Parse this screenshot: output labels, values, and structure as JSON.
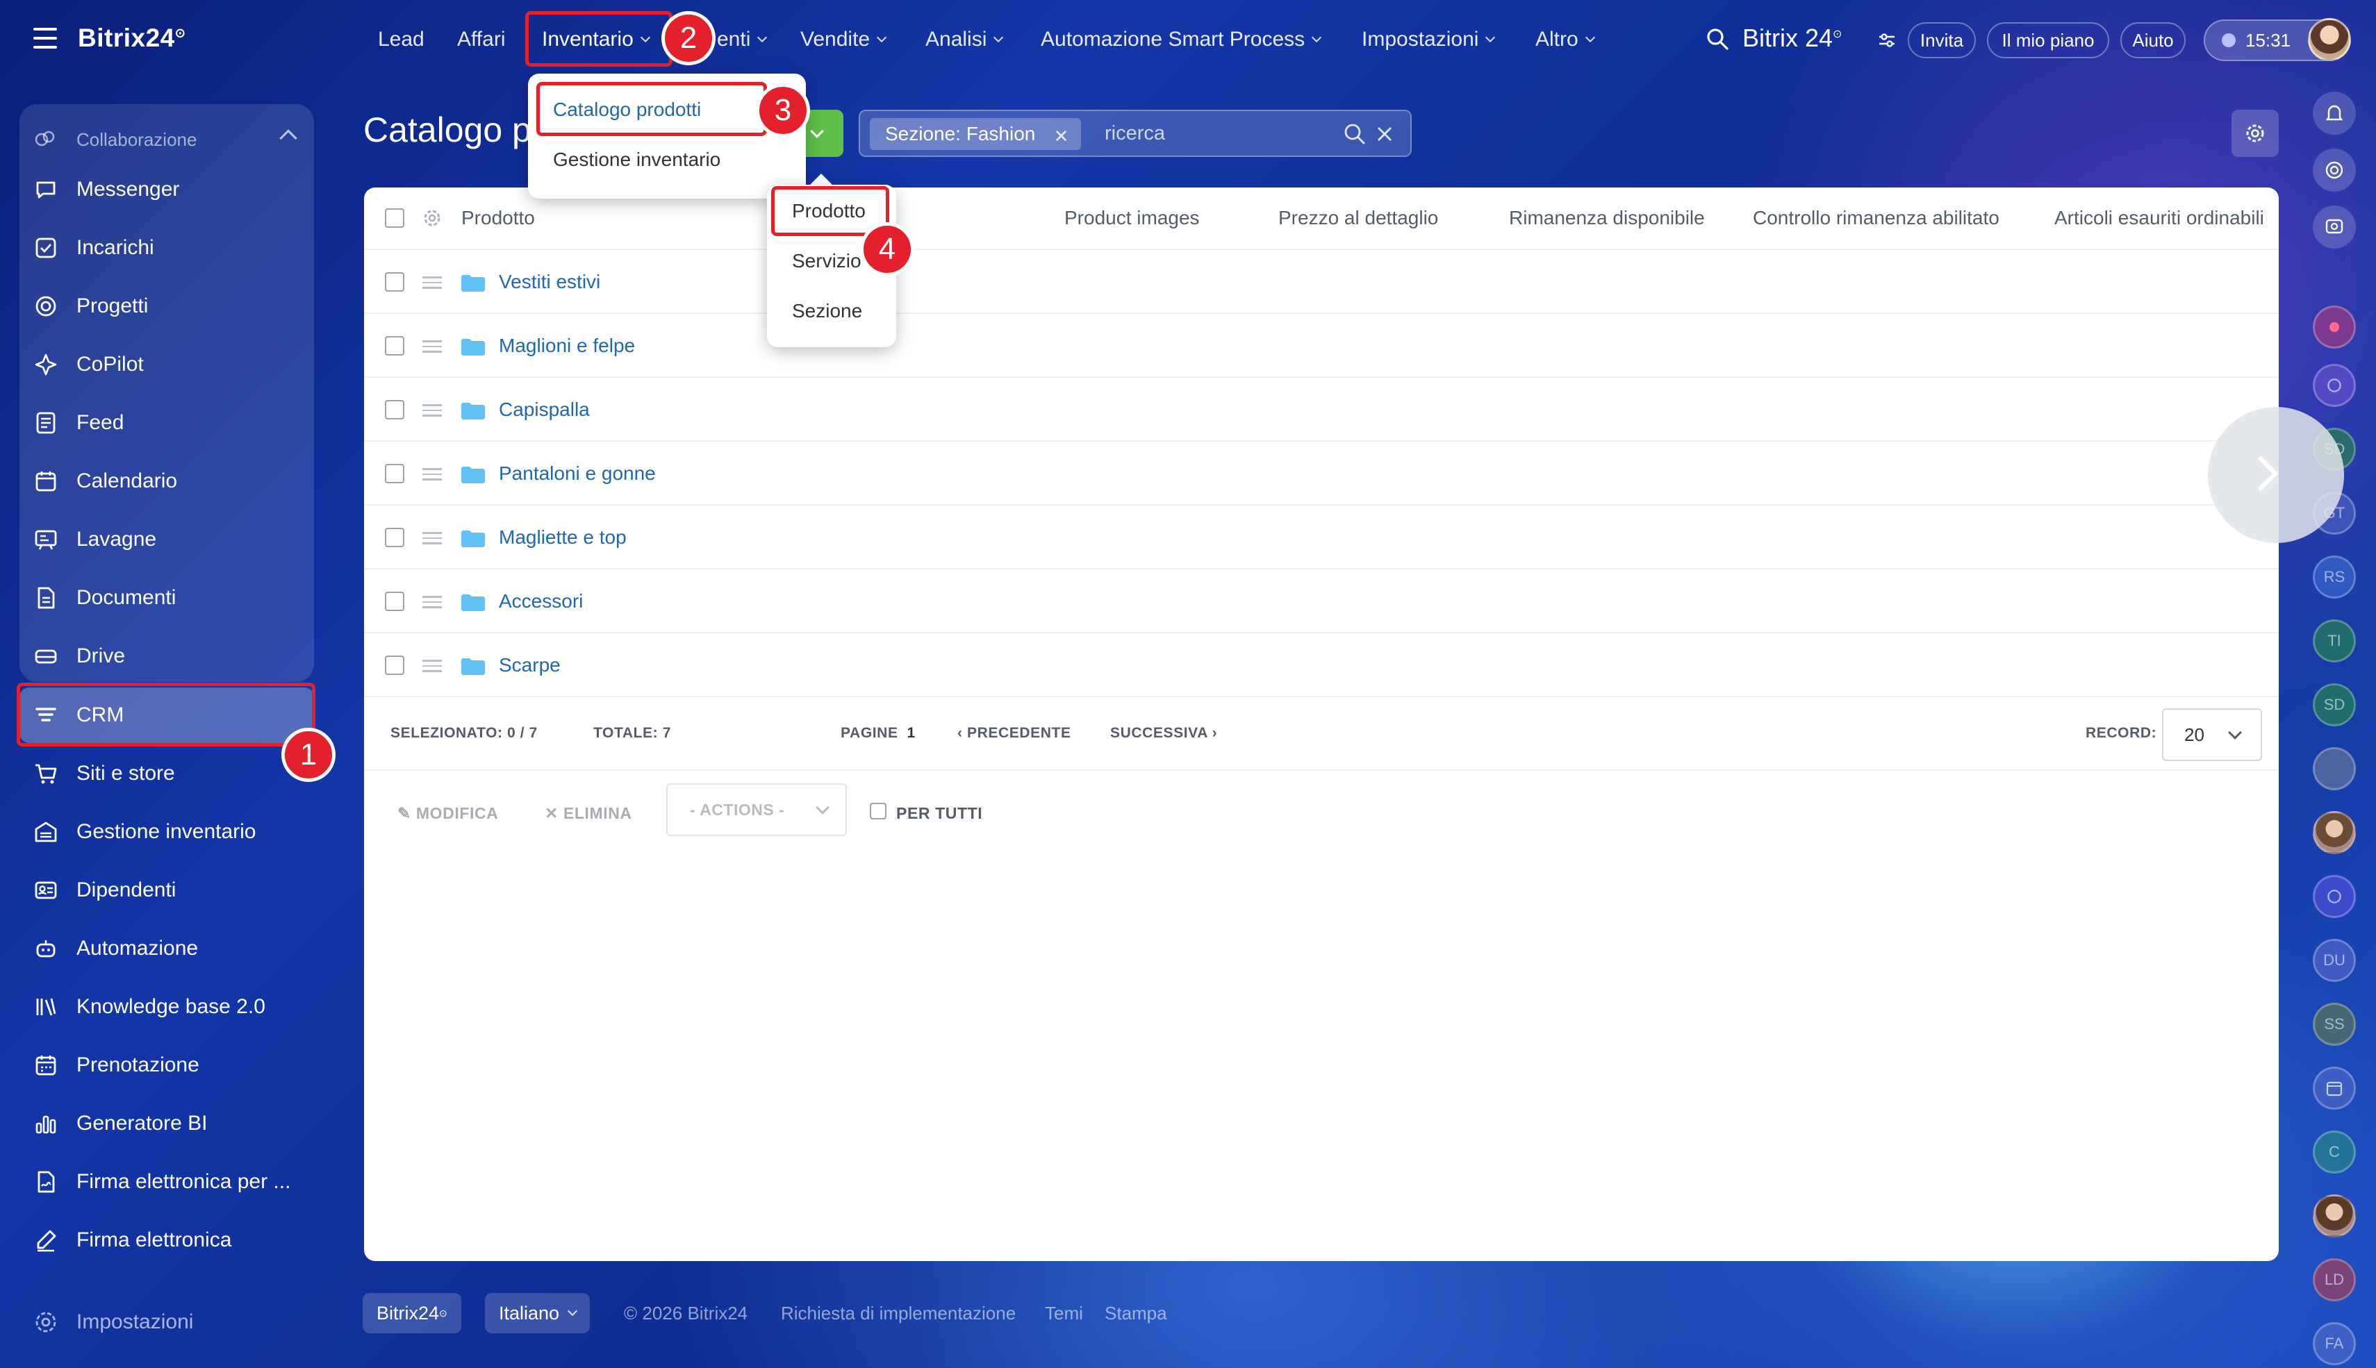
{
  "app": {
    "logo": "Bitrix24",
    "logo_mark": "⊙"
  },
  "sidebar": {
    "group_label": "Collaborazione",
    "group_items": [
      {
        "label": "Messenger",
        "icon": "chat-icon"
      },
      {
        "label": "Incarichi",
        "icon": "checkbox-icon"
      },
      {
        "label": "Progetti",
        "icon": "target-icon"
      },
      {
        "label": "CoPilot",
        "icon": "copilot-icon"
      },
      {
        "label": "Feed",
        "icon": "feed-icon"
      },
      {
        "label": "Calendario",
        "icon": "calendar-icon"
      },
      {
        "label": "Lavagne",
        "icon": "whiteboard-icon"
      },
      {
        "label": "Documenti",
        "icon": "document-icon"
      },
      {
        "label": "Drive",
        "icon": "drive-icon"
      }
    ],
    "items": [
      {
        "label": "CRM",
        "icon": "crm-icon",
        "active": true
      },
      {
        "label": "Siti e store",
        "icon": "cart-icon"
      },
      {
        "label": "Gestione inventario",
        "icon": "inventory-icon"
      },
      {
        "label": "Dipendenti",
        "icon": "employees-icon"
      },
      {
        "label": "Automazione",
        "icon": "robot-icon"
      },
      {
        "label": "Knowledge base 2.0",
        "icon": "books-icon"
      },
      {
        "label": "Prenotazione",
        "icon": "booking-icon"
      },
      {
        "label": "Generatore BI",
        "icon": "chart-icon"
      },
      {
        "label": "Firma elettronica per ...",
        "icon": "e-sign-icon"
      },
      {
        "label": "Firma elettronica",
        "icon": "pen-icon"
      }
    ],
    "settings_label": "Impostazioni"
  },
  "topmenu": {
    "items": [
      {
        "label": "Lead",
        "caret": false
      },
      {
        "label": "Affari",
        "caret": false
      },
      {
        "label": "Inventario",
        "caret": true
      },
      {
        "label": "enti",
        "caret": true
      },
      {
        "label": "Vendite",
        "caret": true
      },
      {
        "label": "Analisi",
        "caret": true
      },
      {
        "label": "Automazione Smart Process",
        "caret": true
      },
      {
        "label": "Impostazioni",
        "caret": true
      },
      {
        "label": "Altro",
        "caret": true
      }
    ]
  },
  "topbar": {
    "brand": "Bitrix 24",
    "invite": "Invita",
    "plan": "Il mio piano",
    "help": "Aiuto",
    "time": "15:31"
  },
  "inventory_menu": {
    "items": [
      "Catalogo prodotti",
      "Gestione inventario"
    ]
  },
  "add_menu": {
    "items": [
      "Prodotto",
      "Servizio",
      "Sezione"
    ]
  },
  "page": {
    "title": "Catalogo p",
    "filter_chip": "Sezione: Fashion",
    "search_placeholder": "ricerca"
  },
  "table": {
    "columns": [
      "Prodotto",
      "Product images",
      "Prezzo al dettaglio",
      "Rimanenza disponibile",
      "Controllo rimanenza abilitato",
      "Articoli esauriti ordinabili"
    ],
    "rows": [
      "Vestiti estivi",
      "Maglioni e felpe",
      "Capispalla",
      "Pantaloni e gonne",
      "Magliette e top",
      "Accessori",
      "Scarpe"
    ]
  },
  "pagination": {
    "selected_label": "SELEZIONATO:",
    "selected_value": "0 / 7",
    "total_label": "TOTALE:",
    "total_value": "7",
    "pages_label": "PAGINE",
    "page_value": "1",
    "prev": "PRECEDENTE",
    "next": "SUCCESSIVA",
    "record_label": "RECORD:",
    "record_value": "20"
  },
  "actions": {
    "edit": "MODIFICA",
    "delete": "ELIMINA",
    "select": "- ACTIONS -",
    "for_all": "PER TUTTI"
  },
  "rail": {
    "avatars": [
      "SD",
      "GT",
      "RS",
      "TI",
      "SD",
      "DU",
      "SS",
      "C",
      "LD",
      "FA"
    ]
  },
  "footer": {
    "brand": "Bitrix24",
    "language": "Italiano",
    "copyright": "© 2026 Bitrix24",
    "links": [
      "Richiesta di implementazione",
      "Temi",
      "Stampa"
    ]
  },
  "annotations": [
    "1",
    "2",
    "3",
    "4"
  ],
  "colors": {
    "accent_red": "#e3202b",
    "link_blue": "#2067b0",
    "add_green": "#5fbf48"
  }
}
